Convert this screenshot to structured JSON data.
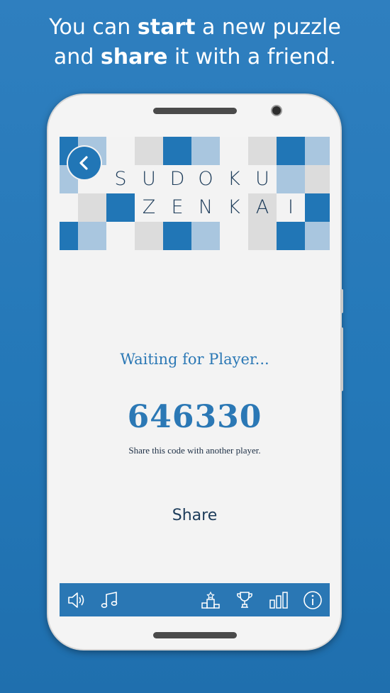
{
  "headline": {
    "line1_pre": "You can ",
    "line1_bold": "start",
    "line1_post": " a new puzzle",
    "line2_pre": "and ",
    "line2_bold": "share",
    "line2_post": " it with a friend."
  },
  "app": {
    "title_row1": [
      "S",
      "U",
      "D",
      "O",
      "K",
      "U"
    ],
    "title_row2": [
      "Z",
      "E",
      "N",
      "K",
      "A",
      "I"
    ],
    "back_icon": "chevron-left-icon",
    "waiting_text": "Waiting for Player...",
    "game_code": "646330",
    "share_hint": "Share this code with another player.",
    "share_label": "Share"
  },
  "toolbar": {
    "icons": [
      "speaker-icon",
      "music-note-icon",
      "podium-icon",
      "trophy-icon",
      "bar-chart-icon",
      "info-icon"
    ]
  },
  "colors": {
    "background": "#2478b8",
    "accent_blue": "#2176b6",
    "light_blue": "#a9c6df",
    "light_gray": "#dcdcdc",
    "text_blue": "#2b78b5",
    "toolbar": "#2a77b4"
  }
}
